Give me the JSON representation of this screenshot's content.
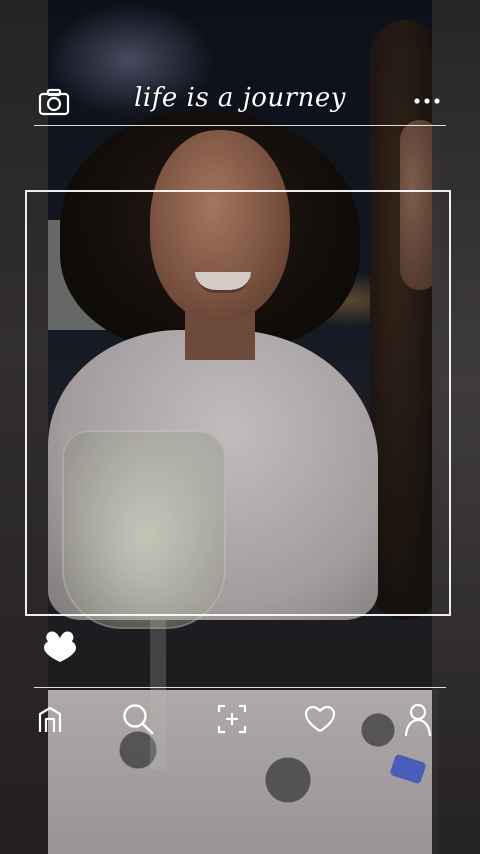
{
  "story": {
    "title": "life is a journey"
  },
  "icons": {
    "camera": "camera-icon",
    "more": "more-dots-icon",
    "like": "heart-filled-icon"
  },
  "nav": {
    "items": [
      {
        "name": "home",
        "icon": "home-icon"
      },
      {
        "name": "search",
        "icon": "search-icon"
      },
      {
        "name": "add",
        "icon": "add-square-icon"
      },
      {
        "name": "activity",
        "icon": "heart-icon"
      },
      {
        "name": "profile",
        "icon": "profile-icon"
      }
    ]
  },
  "colors": {
    "overlay": "#ffffff"
  }
}
